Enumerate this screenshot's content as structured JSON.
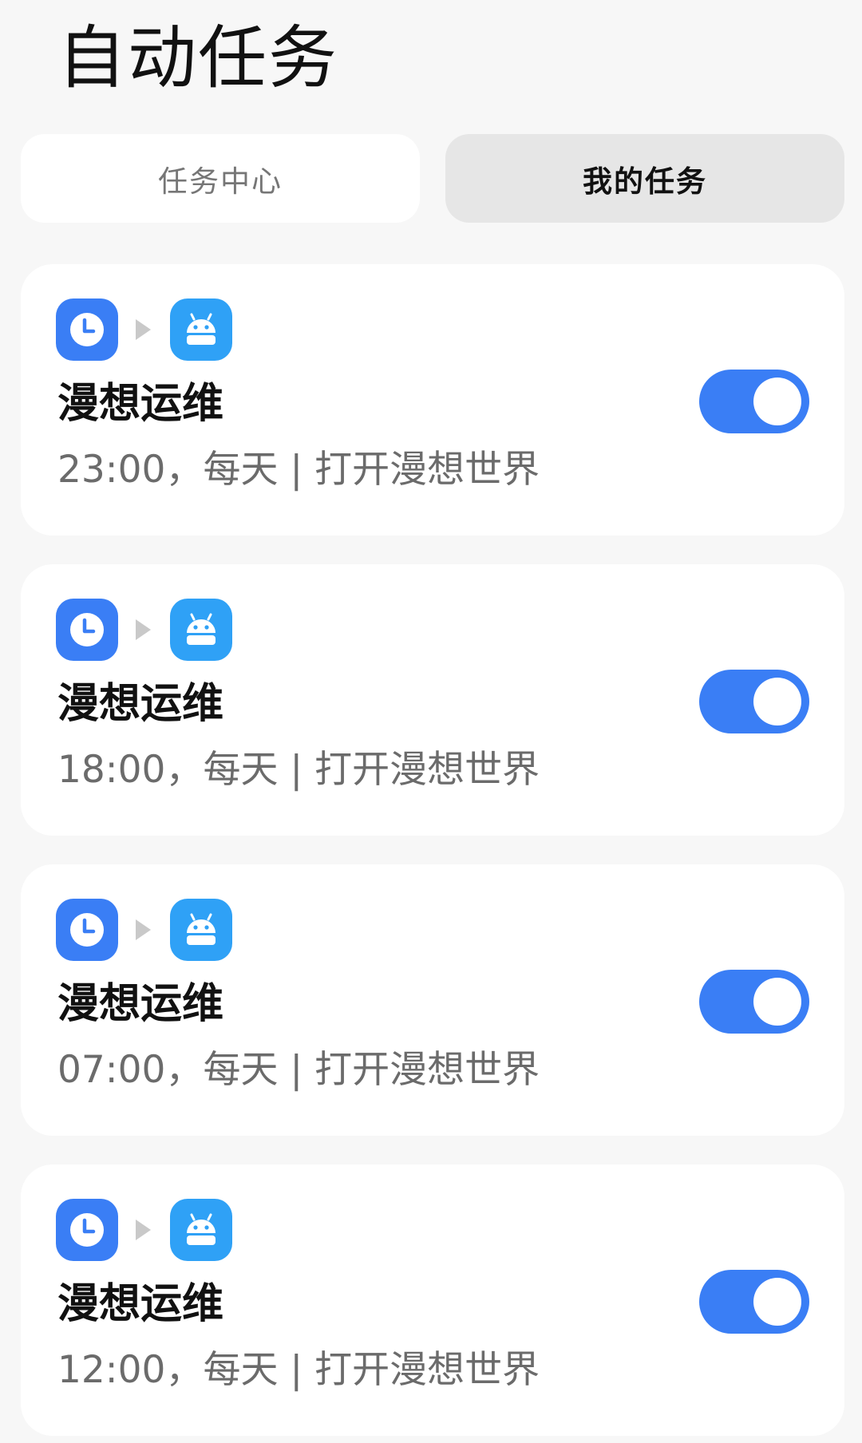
{
  "page": {
    "title": "自动任务"
  },
  "tabs": {
    "task_center": "任务中心",
    "my_tasks": "我的任务"
  },
  "colors": {
    "accent": "#3a7ef5",
    "robot_app": "#2fa1f6",
    "background": "#f7f7f7"
  },
  "tasks": [
    {
      "trigger_icon": "clock-icon",
      "action_icon": "android-robot-icon",
      "name": "漫想运维",
      "description": "23:00，每天 | 打开漫想世界",
      "enabled": true
    },
    {
      "trigger_icon": "clock-icon",
      "action_icon": "android-robot-icon",
      "name": "漫想运维",
      "description": "18:00，每天 | 打开漫想世界",
      "enabled": true
    },
    {
      "trigger_icon": "clock-icon",
      "action_icon": "android-robot-icon",
      "name": "漫想运维",
      "description": "07:00，每天 | 打开漫想世界",
      "enabled": true
    },
    {
      "trigger_icon": "clock-icon",
      "action_icon": "android-robot-icon",
      "name": "漫想运维",
      "description": "12:00，每天 | 打开漫想世界",
      "enabled": true
    }
  ]
}
